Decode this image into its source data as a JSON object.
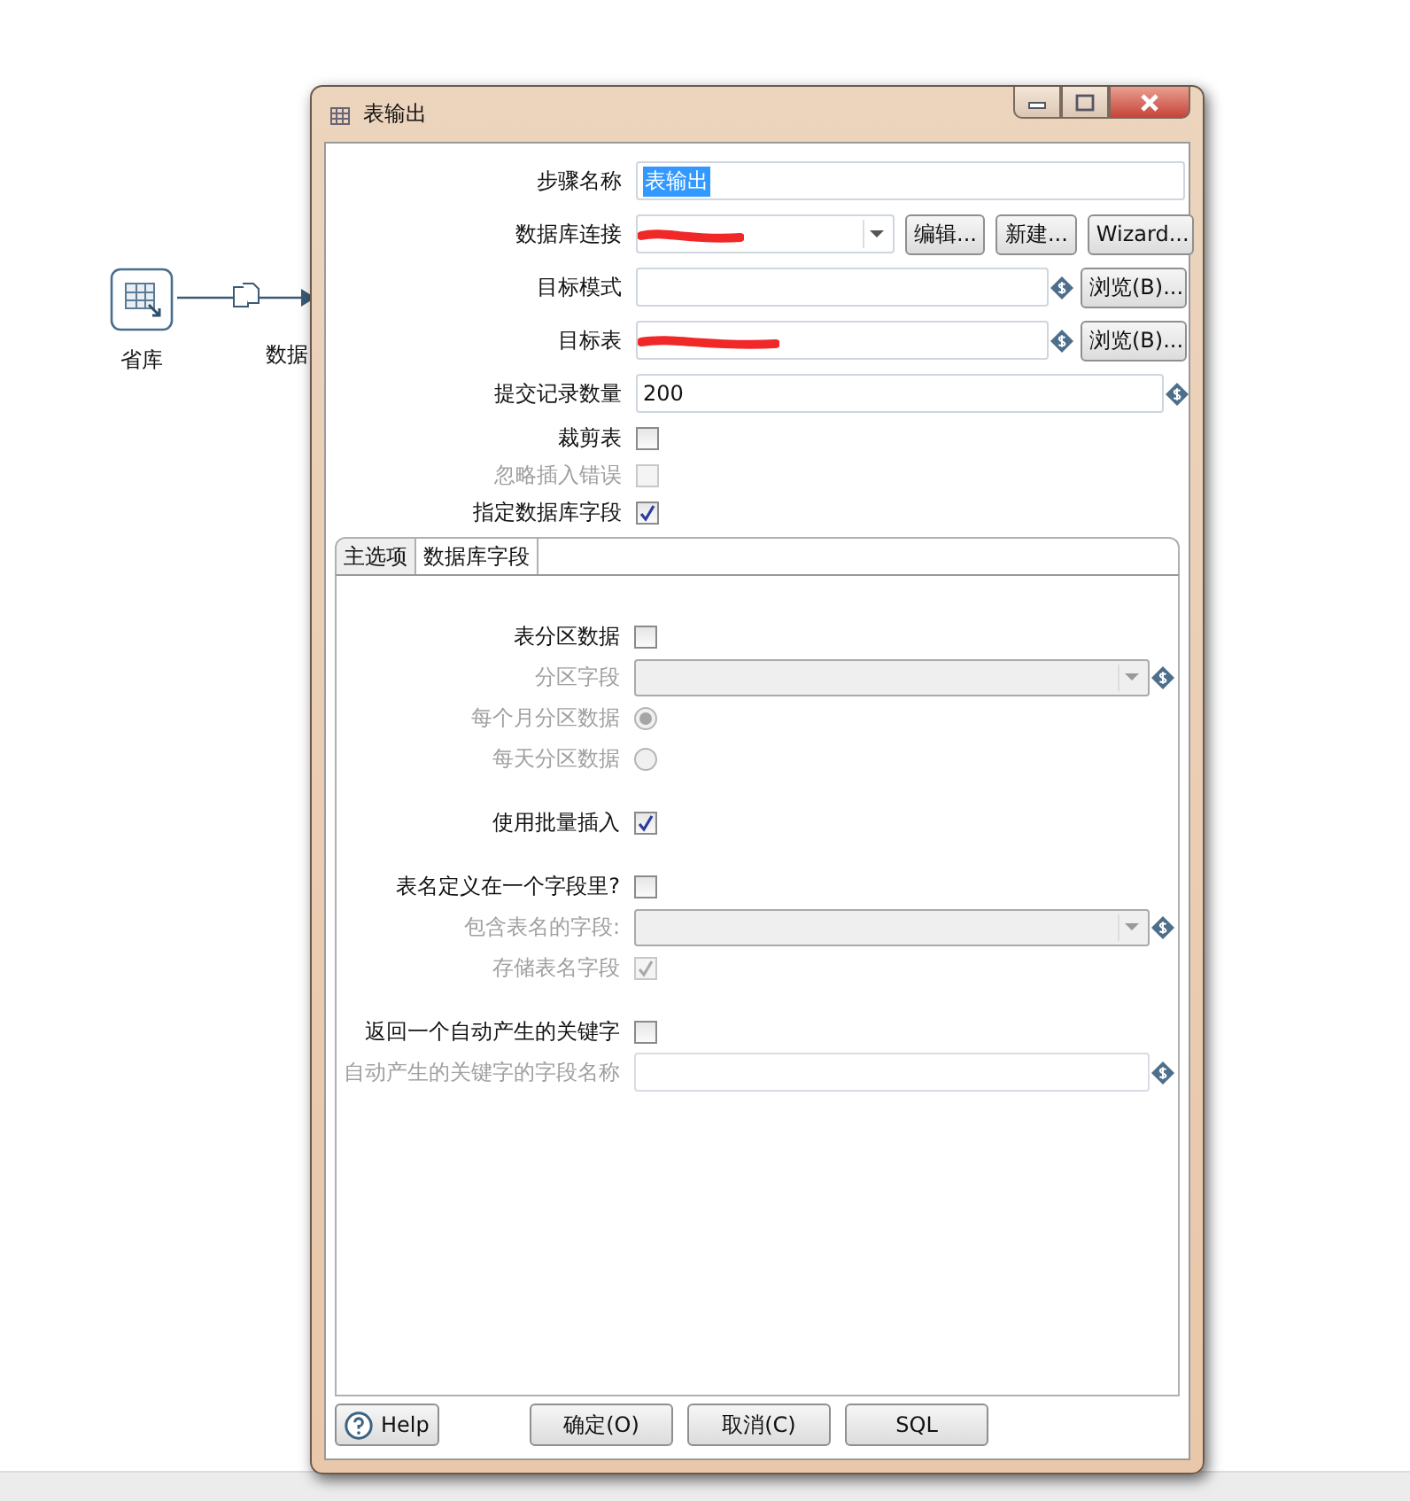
{
  "canvas": {
    "nodes": [
      {
        "label": "省库"
      },
      {
        "label": "数据"
      }
    ]
  },
  "dialog": {
    "title": "表输出",
    "rows": [
      {
        "kind": "text",
        "label": "步骤名称",
        "value": "表输出",
        "highlighted": true
      },
      {
        "kind": "combo",
        "label": "数据库连接",
        "redacted": true,
        "buttons": [
          "编辑...",
          "新建...",
          "Wizard..."
        ]
      },
      {
        "kind": "browse",
        "label": "目标模式",
        "redacted": false,
        "buttons": [
          "浏览(B)..."
        ]
      },
      {
        "kind": "browse",
        "label": "目标表",
        "redacted": true,
        "buttons": [
          "浏览(B)..."
        ]
      },
      {
        "kind": "variable",
        "label": "提交记录数量",
        "value": "200"
      },
      {
        "kind": "checkbox",
        "label": "裁剪表",
        "checked": false,
        "disabled": false
      },
      {
        "kind": "checkbox",
        "label": "忽略插入错误",
        "checked": false,
        "disabled": true
      },
      {
        "kind": "checkbox",
        "label": "指定数据库字段",
        "checked": true,
        "disabled": false
      }
    ],
    "tabs": [
      {
        "label": "主选项",
        "selected": true
      },
      {
        "label": "数据库字段",
        "selected": false
      }
    ],
    "groups": [
      [
        {
          "kind": "checkbox",
          "label": "表分区数据",
          "checked": false,
          "disabled": false
        },
        {
          "kind": "combo",
          "label": "分区字段",
          "disabled": true
        },
        {
          "kind": "radio",
          "label": "每个月分区数据",
          "selected": true,
          "disabled": true
        },
        {
          "kind": "radio",
          "label": "每天分区数据",
          "selected": false,
          "disabled": true
        }
      ],
      [
        {
          "kind": "checkbox",
          "label": "使用批量插入",
          "checked": true,
          "disabled": false
        }
      ],
      [
        {
          "kind": "checkbox",
          "label": "表名定义在一个字段里?",
          "checked": false,
          "disabled": false
        },
        {
          "kind": "combo",
          "label": "包含表名的字段:",
          "disabled": true
        },
        {
          "kind": "checkbox",
          "label": "存储表名字段",
          "checked": true,
          "disabled": true
        }
      ],
      [
        {
          "kind": "checkbox",
          "label": "返回一个自动产生的关键字",
          "checked": false,
          "disabled": false
        },
        {
          "kind": "text",
          "label": "自动产生的关键字的字段名称",
          "disabled": true
        }
      ]
    ],
    "help": "Help",
    "buttons": [
      "确定(O)",
      "取消(C)",
      "SQL"
    ]
  }
}
